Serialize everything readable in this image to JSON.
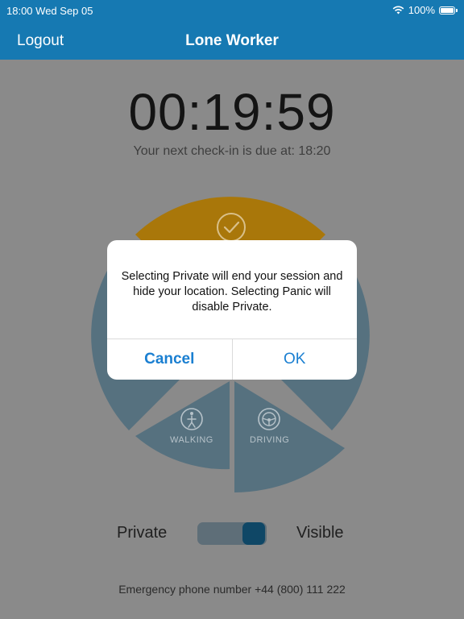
{
  "status_bar": {
    "time": "18:00",
    "date": "Wed Sep 05",
    "battery": "100%"
  },
  "nav": {
    "logout": "Logout",
    "title": "Lone Worker"
  },
  "timer": {
    "value": "00:19:59",
    "due_text": "Your next check-in is due at: 18:20"
  },
  "modes": {
    "walking": "WALKING",
    "driving": "DRIVING"
  },
  "visibility": {
    "private_label": "Private",
    "visible_label": "Visible"
  },
  "emergency": "Emergency phone number +44 (800) 111 222",
  "dialog": {
    "message": "Selecting Private will end your session and hide your location. Selecting Panic will disable Private.",
    "cancel": "Cancel",
    "ok": "OK"
  },
  "colors": {
    "nav_blue": "#1679b2",
    "checkin_gold": "#a9770a",
    "segment_blue": "#56717f",
    "dialog_button_blue": "#1a7fd1"
  }
}
